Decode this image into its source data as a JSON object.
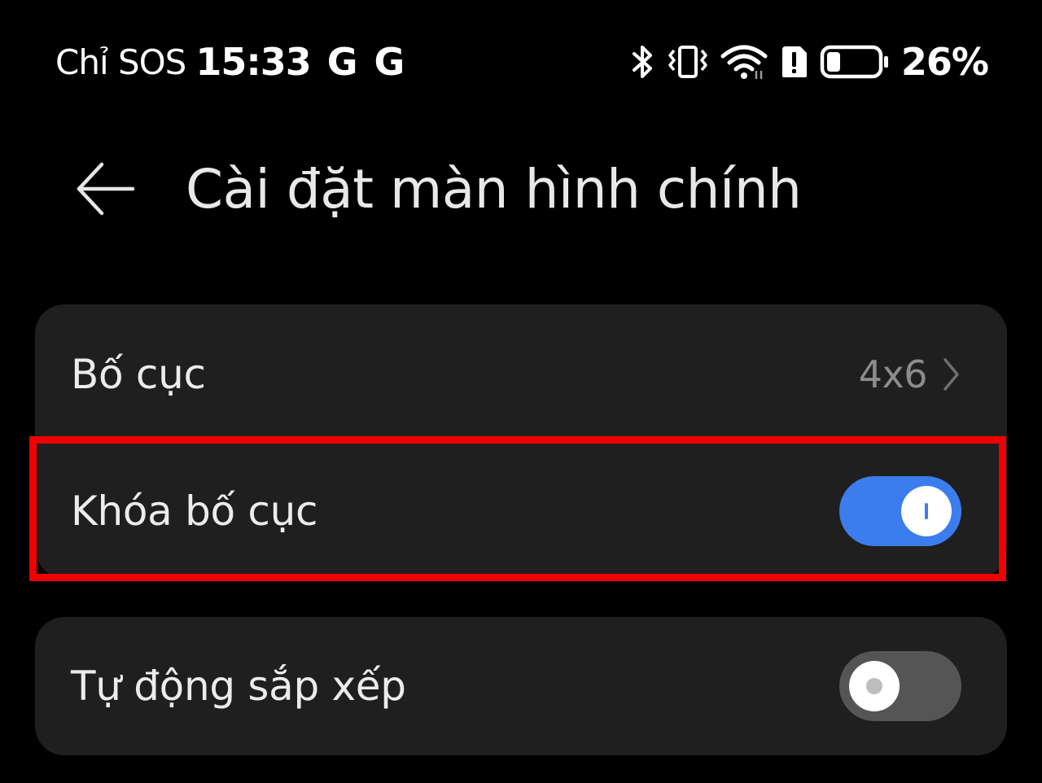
{
  "status_bar": {
    "carrier": "Chỉ SOS",
    "time": "15:33",
    "notification_icons": [
      "G",
      "G"
    ],
    "system_icons": [
      "bluetooth-icon",
      "vibrate-icon",
      "wifi-icon",
      "alert-icon",
      "battery-icon"
    ],
    "battery_percent": "26%",
    "battery_level": 0.26
  },
  "header": {
    "back_icon": "back-arrow-icon",
    "title": "Cài đặt màn hình chính"
  },
  "settings": {
    "layout": {
      "label": "Bố cục",
      "value": "4x6",
      "icon": "chevron-right-icon"
    },
    "lock_layout": {
      "label": "Khóa bố cục",
      "enabled": true
    },
    "auto_arrange": {
      "label": "Tự động sắp xếp",
      "enabled": false
    }
  },
  "colors": {
    "background": "#000000",
    "card": "#1f1f1f",
    "toggle_on": "#3b7ded",
    "toggle_off": "#555555",
    "highlight": "#f00000",
    "secondary_text": "#8c8c8c"
  }
}
